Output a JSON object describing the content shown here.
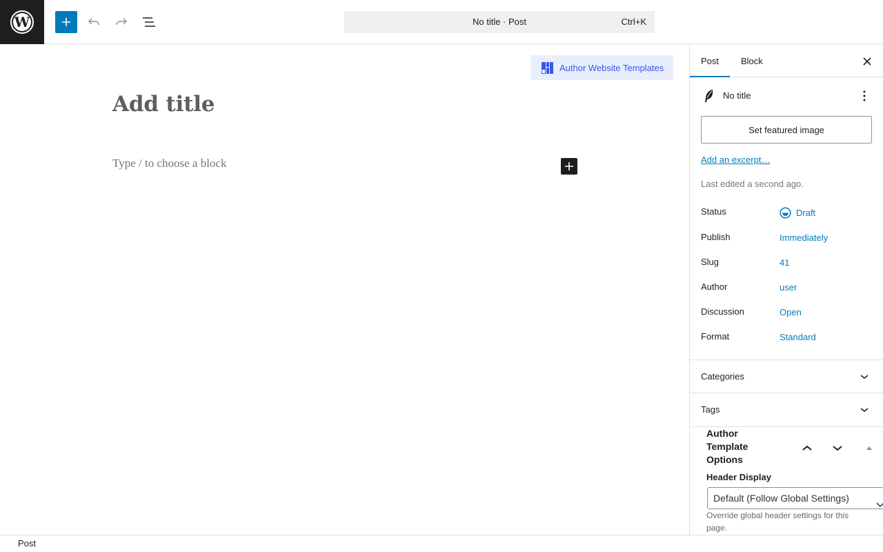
{
  "colors": {
    "accent": "#007cba",
    "templates_bg": "#e9eefd",
    "templates_fg": "#3858e9",
    "logo_bg": "#1e1e1e"
  },
  "toolbar": {
    "logo_icon": "wordpress-logo-icon",
    "add_icon": "plus-icon",
    "undo_icon": "undo-icon",
    "redo_icon": "redo-icon",
    "list_view_icon": "list-view-icon"
  },
  "command_bar": {
    "title": "No title · Post",
    "shortcut": "Ctrl+K"
  },
  "editor": {
    "templates_button": "Author Website Templates",
    "title_placeholder": "Add title",
    "block_placeholder": "Type / to choose a block"
  },
  "sidebar": {
    "tabs": [
      {
        "label": "Post",
        "active": true
      },
      {
        "label": "Block",
        "active": false
      }
    ],
    "post_title": "No title",
    "featured_image_button": "Set featured image",
    "excerpt_link": "Add an excerpt…",
    "last_edited": "Last edited a second ago.",
    "meta": [
      {
        "label": "Status",
        "value": "Draft"
      },
      {
        "label": "Publish",
        "value": "Immediately"
      },
      {
        "label": "Slug",
        "value": "41"
      },
      {
        "label": "Author",
        "value": "user"
      },
      {
        "label": "Discussion",
        "value": "Open"
      },
      {
        "label": "Format",
        "value": "Standard"
      }
    ],
    "panels": [
      {
        "title": "Categories"
      },
      {
        "title": "Tags"
      }
    ],
    "meta_box": {
      "title": "Author Template Options",
      "field_label": "Header Display",
      "select_value": "Default (Follow Global Settings)",
      "help": "Override global header settings for this page."
    }
  },
  "footer": {
    "breadcrumb": "Post"
  }
}
